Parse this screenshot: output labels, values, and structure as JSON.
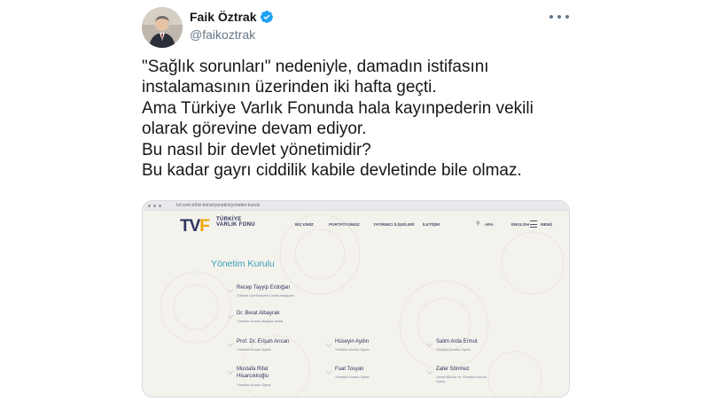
{
  "author": {
    "name": "Faik Öztrak",
    "handle": "@faikoztrak",
    "verified": true
  },
  "tweet_lines": [
    "\"Sağlık sorunları\" nedeniyle, damadın istifasını",
    "instalamasının üzerinden iki hafta geçti.",
    "Ama Türkiye Varlık Fonunda hala kayınpederin vekili",
    "olarak görevine devam ediyor.",
    "Bu nasıl bir devlet yönetimidir?",
    "Bu kadar gayrı ciddilik kabile devletinde bile olmaz."
  ],
  "icons": {
    "more": "more-horizontal-icon",
    "verified": "verified-badge-icon"
  },
  "colors": {
    "accent": "#1da1f2",
    "brand_navy": "#2e3560",
    "brand_orange": "#f0a500",
    "section_title": "#3aa0b6"
  },
  "embedded_page": {
    "url": "tvf.com.tr/biz-kimiz/yonetim/yonetim-kurulu",
    "logo_mark_a": "TV",
    "logo_mark_b": "F",
    "logo_line1": "TÜRKİYE",
    "logo_line2": "VARLIK FONU",
    "nav": [
      "BİZ KİMİZ",
      "PORTFÖYÜMÜZ",
      "YATIRIMCI İLİŞKİLERİ",
      "İLETİŞİM"
    ],
    "search_label": "ARA",
    "language": "ENGLISH",
    "menu_label": "MENÜ",
    "section_title": "Yönetim Kurulu",
    "members": [
      {
        "name": "Recep Tayyip Erdoğan",
        "role": "Türkiye Cumhuriyeti Cumhurbaşkanı"
      },
      {
        "name": "Dr. Berat Albayrak",
        "role": "Yönetim Kurulu Başkan Vekili"
      },
      {
        "name": "Prof. Dr. Erişah Arıcan",
        "role": "Yönetim Kurulu Üyesi"
      },
      {
        "name": "Hüseyin Aydın",
        "role": "Yönetim Kurulu Üyesi"
      },
      {
        "name": "Salim Arda Ermut",
        "role": "Yönetim Kurulu Üyesi"
      },
      {
        "name": "Mustafa Rifat Hisarcıklıoğlu",
        "role": "Yönetim Kurulu Üyesi",
        "name_line1": "Mustafa Rifat",
        "name_line2": "Hisarcıklıoğlu"
      },
      {
        "name": "Fuat Tosyalı",
        "role": "Yönetim Kurulu Üyesi"
      },
      {
        "name": "Zafer Sönmez",
        "role": "Genel Müdür ve Yönetim Kurulu Üyesi",
        "role_line1": "Genel Müdür ve Yönetim Kurulu",
        "role_line2": "Üyesi"
      }
    ]
  }
}
